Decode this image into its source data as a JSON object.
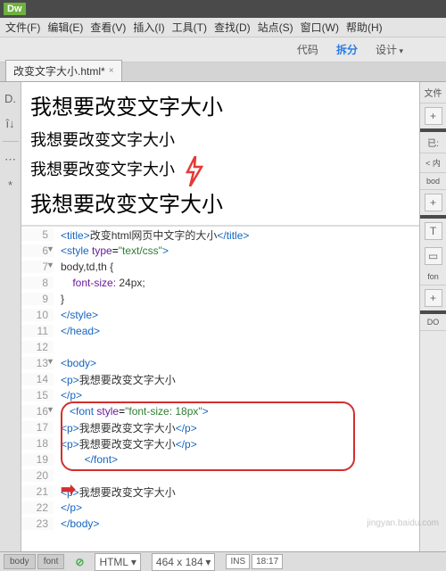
{
  "titlebar": {
    "logo": "Dw"
  },
  "menu": {
    "file": "文件(F)",
    "edit": "编辑(E)",
    "view": "查看(V)",
    "insert": "插入(I)",
    "tools": "工具(T)",
    "find": "查找(D)",
    "site": "站点(S)",
    "window": "窗口(W)",
    "help": "帮助(H)"
  },
  "toolbar": {
    "code": "代码",
    "split": "拆分",
    "design": "设计"
  },
  "tab": {
    "name": "改变文字大小.html*",
    "close": "×"
  },
  "left_icons": [
    "D.",
    "î↓",
    "⋯",
    "*"
  ],
  "preview": {
    "line1": "我想要改变文字大小",
    "line2": "我想要改变文字大小",
    "line3": "我想要改变文字大小",
    "line4": "我想要改变文字大小"
  },
  "right": {
    "label1": "文件",
    "plus": "+",
    "label2": "已:",
    "item1": "< 内",
    "item2": "bod",
    "iconT": "T",
    "iconBox": "▭",
    "iconFont": "fon",
    "iconDom": "DO"
  },
  "code_lines": [
    {
      "num": "5",
      "fold": "",
      "html": "<span class='tag'>&lt;title&gt;</span><span class='txt'>改变html网页中文字的大小</span><span class='tag'>&lt;/title&gt;</span>"
    },
    {
      "num": "6",
      "fold": "▼",
      "html": "<span class='tag'>&lt;style</span> <span class='attr'>type</span>=<span class='str'>\"text/css\"</span><span class='tag'>&gt;</span>"
    },
    {
      "num": "7",
      "fold": "▼",
      "html": "<span class='txt'>body,td,th {</span>"
    },
    {
      "num": "8",
      "fold": "",
      "html": "    <span class='attr'>font-size:</span> <span class='txt'>24px;</span>"
    },
    {
      "num": "9",
      "fold": "",
      "html": "<span class='txt'>}</span>"
    },
    {
      "num": "10",
      "fold": "",
      "html": "<span class='tag'>&lt;/style&gt;</span>"
    },
    {
      "num": "11",
      "fold": "",
      "html": "<span class='tag'>&lt;/head&gt;</span>"
    },
    {
      "num": "12",
      "fold": "",
      "html": ""
    },
    {
      "num": "13",
      "fold": "▼",
      "html": "<span class='tag'>&lt;body&gt;</span>"
    },
    {
      "num": "14",
      "fold": "",
      "html": "<span class='tag'>&lt;p&gt;</span><span class='txt'>我想要改变文字大小</span>"
    },
    {
      "num": "15",
      "fold": "",
      "html": "<span class='tag'>&lt;/p&gt;</span>"
    },
    {
      "num": "16",
      "fold": "▼",
      "html": "   <span class='tag'>&lt;font</span> <span class='attr'>style</span>=<span class='str'>\"font-size: 18px\"</span><span class='tag'>&gt;</span>"
    },
    {
      "num": "17",
      "fold": "",
      "html": "<span class='tag'>&lt;p&gt;</span><span class='txt'>我想要改变文字大小</span><span class='tag'>&lt;/p&gt;</span>"
    },
    {
      "num": "18",
      "fold": "",
      "html": "<span class='tag'>&lt;p&gt;</span><span class='txt'>我想要改变文字大小</span><span class='tag'>&lt;/p&gt;</span>"
    },
    {
      "num": "19",
      "fold": "",
      "html": "        <span class='tag'>&lt;/font&gt;</span>"
    },
    {
      "num": "20",
      "fold": "",
      "html": ""
    },
    {
      "num": "21",
      "fold": "",
      "html": "<span class='tag'>&lt;p&gt;</span><span class='txt'>我想要改变文字大小</span>"
    },
    {
      "num": "22",
      "fold": "",
      "html": "<span class='tag'>&lt;/p&gt;</span>"
    },
    {
      "num": "23",
      "fold": "",
      "html": "<span class='tag'>&lt;/body&gt;</span>"
    }
  ],
  "status": {
    "crumb1": "body",
    "crumb2": "font",
    "check": "⊘",
    "lang": "HTML",
    "lang_arrow": "▾",
    "dims": "464 x 184",
    "dims_arrow": "▾",
    "ins": "INS",
    "pos": "18:17"
  },
  "watermark": "jingyan.baidu.com"
}
